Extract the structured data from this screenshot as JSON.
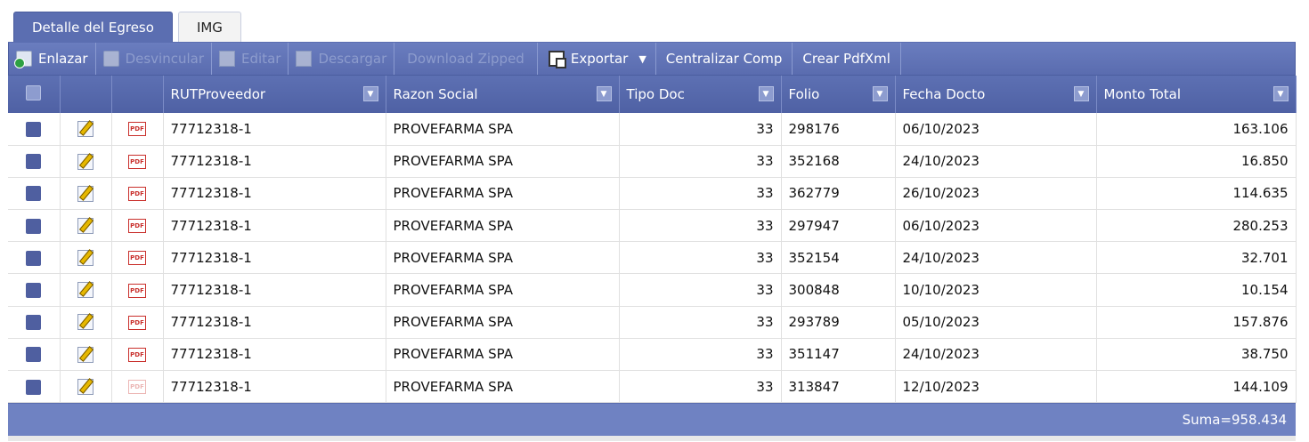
{
  "tabs": [
    {
      "label": "Detalle del Egreso",
      "active": true
    },
    {
      "label": "IMG",
      "active": false
    }
  ],
  "toolbar": {
    "enlazar": "Enlazar",
    "desvincular": "Desvincular",
    "editar": "Editar",
    "descargar": "Descargar",
    "download_zipped": "Download Zipped",
    "exportar": "Exportar",
    "centralizar": "Centralizar Comp",
    "crear_pdf": "Crear PdfXml"
  },
  "columns": {
    "rut": "RUTProveedor",
    "razon": "Razon Social",
    "tipo": "Tipo Doc",
    "folio": "Folio",
    "fecha": "Fecha Docto",
    "monto": "Monto Total"
  },
  "rows": [
    {
      "rut": "77712318-1",
      "razon": "PROVEFARMA SPA",
      "tipo": "33",
      "folio": "298176",
      "fecha": "06/10/2023",
      "monto": "163.106"
    },
    {
      "rut": "77712318-1",
      "razon": "PROVEFARMA SPA",
      "tipo": "33",
      "folio": "352168",
      "fecha": "24/10/2023",
      "monto": "16.850"
    },
    {
      "rut": "77712318-1",
      "razon": "PROVEFARMA SPA",
      "tipo": "33",
      "folio": "362779",
      "fecha": "26/10/2023",
      "monto": "114.635"
    },
    {
      "rut": "77712318-1",
      "razon": "PROVEFARMA SPA",
      "tipo": "33",
      "folio": "297947",
      "fecha": "06/10/2023",
      "monto": "280.253"
    },
    {
      "rut": "77712318-1",
      "razon": "PROVEFARMA SPA",
      "tipo": "33",
      "folio": "352154",
      "fecha": "24/10/2023",
      "monto": "32.701"
    },
    {
      "rut": "77712318-1",
      "razon": "PROVEFARMA SPA",
      "tipo": "33",
      "folio": "300848",
      "fecha": "10/10/2023",
      "monto": "10.154"
    },
    {
      "rut": "77712318-1",
      "razon": "PROVEFARMA SPA",
      "tipo": "33",
      "folio": "293789",
      "fecha": "05/10/2023",
      "monto": "157.876"
    },
    {
      "rut": "77712318-1",
      "razon": "PROVEFARMA SPA",
      "tipo": "33",
      "folio": "351147",
      "fecha": "24/10/2023",
      "monto": "38.750"
    },
    {
      "rut": "77712318-1",
      "razon": "PROVEFARMA SPA",
      "tipo": "33",
      "folio": "313847",
      "fecha": "12/10/2023",
      "monto": "144.109"
    }
  ],
  "footer": {
    "suma": "Suma=958.434"
  },
  "colors": {
    "accent": "#5b6eb1",
    "footer": "#6f82c2",
    "checkbox": "#4f5fa0",
    "pdf": "#c9302c"
  },
  "icons": [
    "link-add-icon",
    "unlink-icon",
    "edit-icon",
    "pdf-icon",
    "export-icon",
    "chevron-down-icon",
    "column-menu-icon"
  ]
}
